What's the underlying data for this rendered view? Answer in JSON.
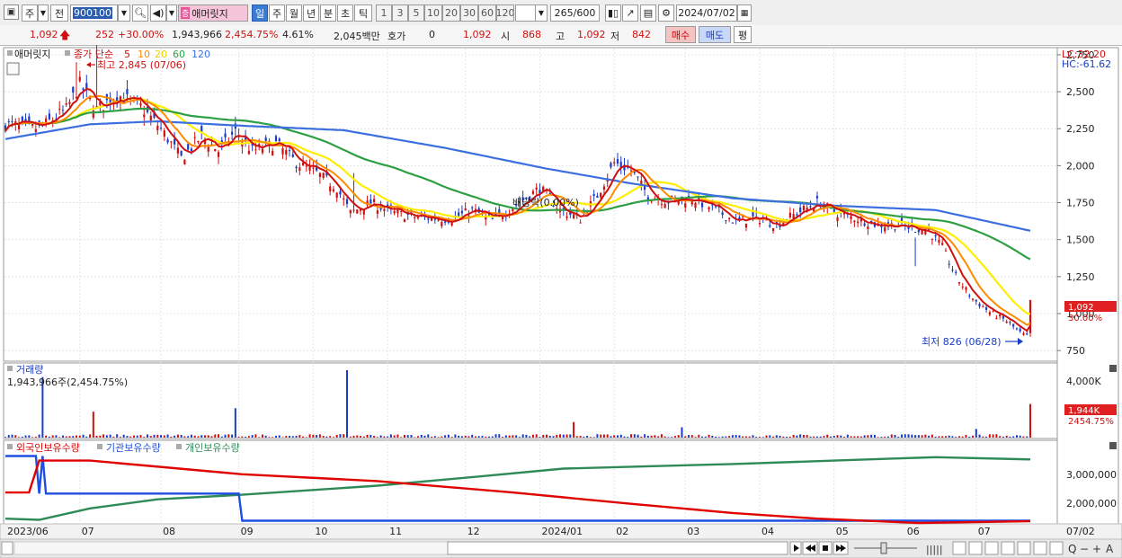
{
  "toolbar": {
    "market_label": "주",
    "prev_label": "전",
    "code": "900100",
    "name": "애머릿지",
    "period_tabs": [
      "일",
      "주",
      "월",
      "년",
      "분",
      "초",
      "틱"
    ],
    "minute_buttons": [
      "1",
      "3",
      "5",
      "10",
      "20",
      "30",
      "60",
      "120"
    ],
    "count": "265",
    "count_max": "/600",
    "date": "2024/07/02"
  },
  "quote": {
    "price": "1,092",
    "change": "252",
    "change_pct": "+30.00%",
    "volume": "1,943,966",
    "volume_ratio": "2,454.75%",
    "turnover": "4.61%",
    "amount": "2,045백만",
    "hoga_label": "호가",
    "hoga_value": "0",
    "hoga_price": "1,092",
    "open_label": "시",
    "open": "868",
    "high_label": "고",
    "high": "1,092",
    "low_label": "저",
    "low": "842",
    "buy_button": "매수",
    "sell_button": "매도",
    "eval_button": "평"
  },
  "colors": {
    "up": "#d01010",
    "down": "#1a3cc8",
    "ma5": "#d01010",
    "ma10": "#ff8c00",
    "ma20": "#ffee00",
    "ma60": "#2ea043",
    "ma120": "#3b6fe0",
    "foreign": "#e00000",
    "inst": "#1f4fe0",
    "retail": "#2e8b57"
  },
  "chart_data": [
    {
      "type": "candlestick",
      "legend_name": "애머릿지",
      "legend_prefix": "종가 단순",
      "ma_periods": [
        "5",
        "10",
        "20",
        "60",
        "120"
      ],
      "y_ticks": [
        750,
        1000,
        1250,
        1500,
        1750,
        2000,
        2250,
        2500,
        2750
      ],
      "y_tick_labels": [
        "750",
        "1,000",
        "1,250",
        "1,500",
        "1,750",
        "2,000",
        "2,250",
        "2,500",
        "2,750"
      ],
      "ylim": [
        690,
        2780
      ],
      "lc_label": "LC:32.20",
      "hc_label": "HC:-61.62",
      "high_annotation": "최고 2,845 (07/06)",
      "low_annotation": "최저 826 (06/28)",
      "event_annotation": "배당락(0.00%)",
      "last_price_label": "1,092",
      "last_pct_label": "30.00%",
      "months": [
        "2023/06",
        "07",
        "08",
        "09",
        "10",
        "11",
        "12",
        "2024/01",
        "02",
        "03",
        "04",
        "05",
        "06",
        "07"
      ],
      "axis_end_label": "07/02",
      "keypoints": [
        [
          0,
          2280
        ],
        [
          10,
          2250
        ],
        [
          18,
          2380
        ],
        [
          22,
          2550
        ],
        [
          27,
          2380
        ],
        [
          33,
          2480
        ],
        [
          40,
          2400
        ],
        [
          46,
          2250
        ],
        [
          52,
          2050
        ],
        [
          58,
          2200
        ],
        [
          63,
          2100
        ],
        [
          68,
          2230
        ],
        [
          73,
          2100
        ],
        [
          80,
          2150
        ],
        [
          86,
          2020
        ],
        [
          92,
          1950
        ],
        [
          98,
          1850
        ],
        [
          102,
          1680
        ],
        [
          108,
          1750
        ],
        [
          115,
          1680
        ],
        [
          122,
          1650
        ],
        [
          132,
          1640
        ],
        [
          138,
          1700
        ],
        [
          144,
          1630
        ],
        [
          152,
          1750
        ],
        [
          158,
          1850
        ],
        [
          164,
          1700
        ],
        [
          170,
          1640
        ],
        [
          175,
          1800
        ],
        [
          180,
          2020
        ],
        [
          185,
          1970
        ],
        [
          190,
          1800
        ],
        [
          196,
          1760
        ],
        [
          203,
          1780
        ],
        [
          210,
          1700
        ],
        [
          216,
          1620
        ],
        [
          222,
          1650
        ],
        [
          228,
          1600
        ],
        [
          234,
          1680
        ],
        [
          240,
          1750
        ],
        [
          246,
          1680
        ],
        [
          252,
          1640
        ],
        [
          258,
          1600
        ],
        [
          263,
          1600
        ],
        [
          268,
          1580
        ],
        [
          273,
          1560
        ],
        [
          277,
          1450
        ],
        [
          281,
          1250
        ],
        [
          286,
          1100
        ],
        [
          291,
          1010
        ],
        [
          296,
          950
        ],
        [
          300,
          870
        ],
        [
          302,
          845
        ],
        [
          303,
          1092
        ]
      ],
      "ma120_points": [
        [
          0,
          2180
        ],
        [
          25,
          2280
        ],
        [
          45,
          2300
        ],
        [
          70,
          2270
        ],
        [
          100,
          2240
        ],
        [
          130,
          2120
        ],
        [
          160,
          1980
        ],
        [
          185,
          1880
        ],
        [
          215,
          1780
        ],
        [
          245,
          1730
        ],
        [
          275,
          1700
        ],
        [
          303,
          1560
        ]
      ]
    },
    {
      "type": "bar",
      "legend": "거래량",
      "current_text": "1,943,966주(2,454.75%)",
      "y_tick_labels": [
        "4,000K"
      ],
      "last_value_label": "1,944K",
      "last_pct_label": "2454.75%"
    },
    {
      "type": "line",
      "series_names": [
        "외국인보유수량",
        "기관보유수량",
        "개인보유수량"
      ],
      "y_tick_labels": [
        "3,000,000",
        "2,000,000"
      ],
      "foreign_points": [
        [
          0,
          2200
        ],
        [
          7,
          2200
        ],
        [
          10,
          3600
        ],
        [
          25,
          3600
        ],
        [
          70,
          3000
        ],
        [
          110,
          2700
        ],
        [
          150,
          2200
        ],
        [
          185,
          1700
        ],
        [
          215,
          1300
        ],
        [
          240,
          1050
        ],
        [
          270,
          860
        ],
        [
          303,
          940
        ]
      ],
      "inst_points": [
        [
          0,
          3800
        ],
        [
          9,
          3800
        ],
        [
          10,
          2150
        ],
        [
          11,
          3800
        ],
        [
          12,
          2150
        ],
        [
          69,
          2150
        ],
        [
          70,
          960
        ],
        [
          303,
          960
        ]
      ],
      "retail_points": [
        [
          0,
          1050
        ],
        [
          10,
          1000
        ],
        [
          25,
          1500
        ],
        [
          45,
          1900
        ],
        [
          70,
          2100
        ],
        [
          110,
          2500
        ],
        [
          140,
          2900
        ],
        [
          165,
          3250
        ],
        [
          190,
          3350
        ],
        [
          215,
          3450
        ],
        [
          245,
          3600
        ],
        [
          275,
          3750
        ],
        [
          303,
          3650
        ]
      ]
    }
  ]
}
